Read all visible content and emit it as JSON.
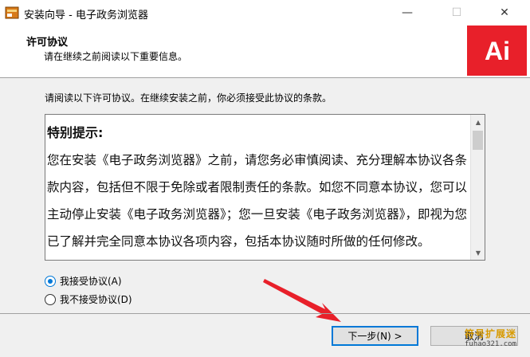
{
  "window": {
    "title": "安装向导 - 电子政务浏览器",
    "controls": {
      "minimize": "—",
      "maximize": "☐",
      "close": "✕"
    }
  },
  "header": {
    "title": "许可协议",
    "subtitle": "请在继续之前阅读以下重要信息。",
    "logo_text": "Ai",
    "logo_color": "#e8202a"
  },
  "main": {
    "intro": "请阅读以下许可协议。在继续安装之前，你必须接受此协议的条款。",
    "license": {
      "heading": "特别提示:",
      "body": "您在安装《电子政务浏览器》之前，请您务必审慎阅读、充分理解本协议各条款内容，包括但不限于免除或者限制责任的条款。如您不同意本协议，您可以主动停止安装《电子政务浏览器》；您一旦安装《电子政务浏览器》，即视为您已了解并完全同意本协议各项内容，包括本协议随时所做的任何修改。"
    },
    "options": {
      "accept": "我接受协议(A)",
      "decline": "我不接受协议(D)",
      "selected": "accept"
    }
  },
  "footer": {
    "next": "下一步(N) >",
    "cancel": "取消"
  },
  "watermark": {
    "line1": "符号扩展迷",
    "line2": "fuhao321.com"
  },
  "colors": {
    "accent": "#0078d7",
    "arrow": "#e8202a"
  }
}
